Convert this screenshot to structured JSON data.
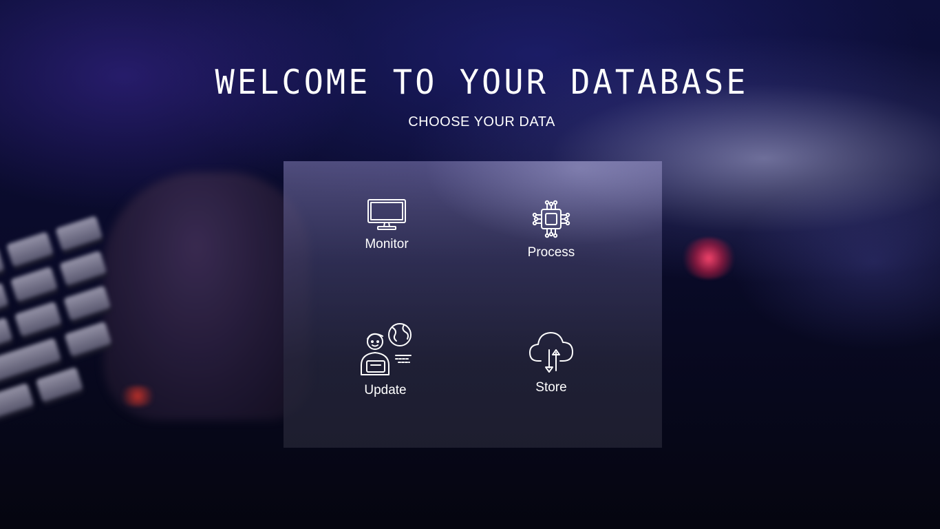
{
  "header": {
    "title": "WELCOME TO YOUR DATABASE",
    "subtitle": "CHOOSE YOUR DATA"
  },
  "menu": {
    "items": [
      {
        "label": "Monitor",
        "icon": "monitor-icon"
      },
      {
        "label": "Process",
        "icon": "cpu-chip-icon"
      },
      {
        "label": "Update",
        "icon": "user-globe-icon"
      },
      {
        "label": "Store",
        "icon": "cloud-transfer-icon"
      }
    ]
  },
  "colors": {
    "text": "#ffffff",
    "background": "#0a0b2c",
    "panel": "#46446e"
  }
}
